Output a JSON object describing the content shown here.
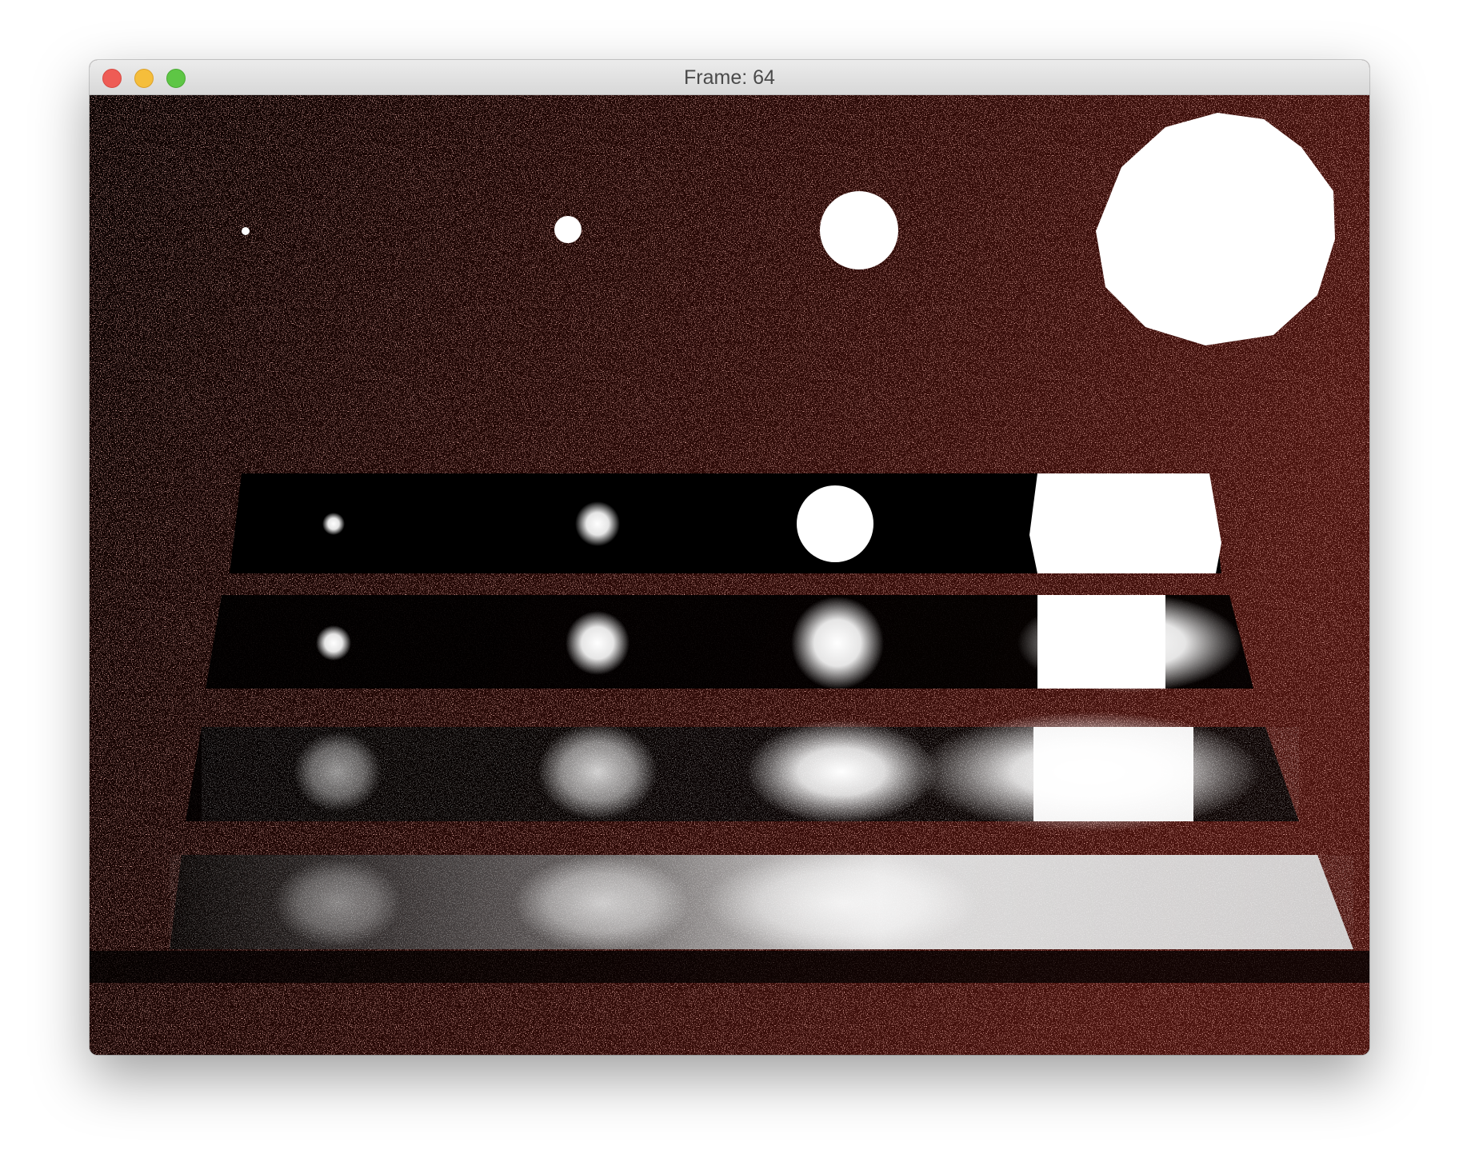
{
  "window": {
    "title": "Frame: 64",
    "buttons": {
      "close": "close",
      "minimize": "minimize",
      "maximize": "maximize"
    },
    "colors": {
      "close": "#ee5c55",
      "minimize": "#f5be3b",
      "maximize": "#5ec645"
    }
  },
  "render": {
    "background_color": "#3a0d0a",
    "light_color": "#ffffff",
    "shadow_color": "#000000"
  }
}
